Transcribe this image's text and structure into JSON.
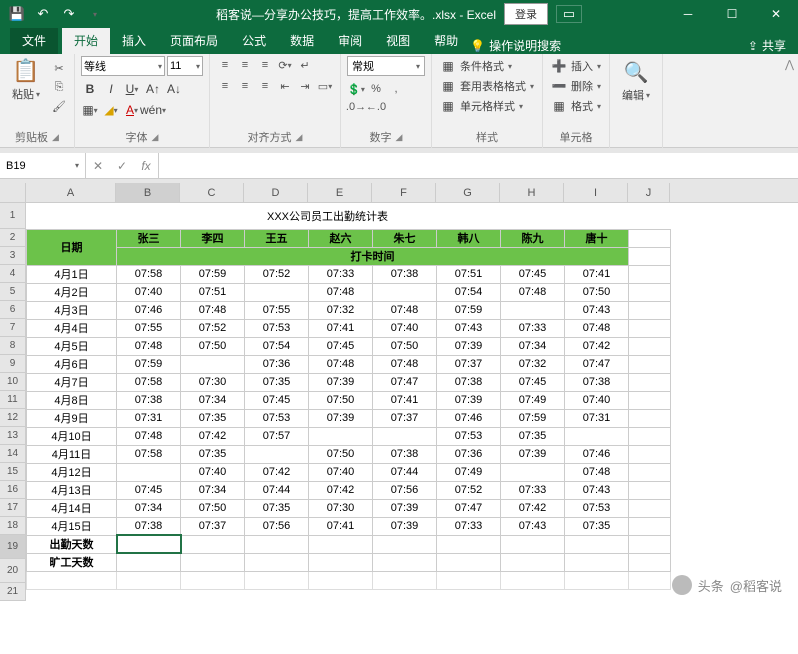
{
  "titlebar": {
    "title_text": "稻客说—分享办公技巧，提高工作效率。.xlsx - Excel",
    "login": "登录"
  },
  "tabs": {
    "file": "文件",
    "items": [
      "开始",
      "插入",
      "页面布局",
      "公式",
      "数据",
      "审阅",
      "视图",
      "帮助"
    ],
    "tellme": "操作说明搜索",
    "share": "共享"
  },
  "ribbon": {
    "paste": "粘贴",
    "clipboard": "剪贴板",
    "font_name": "等线",
    "font_size": "11",
    "font": "字体",
    "align": "对齐方式",
    "number_format": "常规",
    "number": "数字",
    "cond_format": "条件格式",
    "table_format": "套用表格格式",
    "cell_style": "单元格样式",
    "styles": "样式",
    "insert": "插入",
    "delete": "删除",
    "format": "格式",
    "cells": "单元格",
    "edit": "编辑"
  },
  "formula": {
    "name_box": "B19"
  },
  "columns": [
    "A",
    "B",
    "C",
    "D",
    "E",
    "F",
    "G",
    "H",
    "I",
    "J"
  ],
  "rows": [
    "1",
    "2",
    "3",
    "4",
    "5",
    "6",
    "7",
    "8",
    "9",
    "10",
    "11",
    "12",
    "13",
    "14",
    "15",
    "16",
    "17",
    "18",
    "19",
    "20",
    "21"
  ],
  "sheet": {
    "title": "XXX公司员工出勤统计表",
    "date_header": "日期",
    "sub_header": "打卡时间",
    "names": [
      "张三",
      "李四",
      "王五",
      "赵六",
      "朱七",
      "韩八",
      "陈九",
      "唐十"
    ],
    "data": [
      {
        "date": "4月1日",
        "v": [
          "07:58",
          "07:59",
          "07:52",
          "07:33",
          "07:38",
          "07:51",
          "07:45",
          "07:41"
        ]
      },
      {
        "date": "4月2日",
        "v": [
          "07:40",
          "07:51",
          "",
          "07:48",
          "",
          "07:54",
          "07:48",
          "07:50"
        ]
      },
      {
        "date": "4月3日",
        "v": [
          "07:46",
          "07:48",
          "07:55",
          "07:32",
          "07:48",
          "07:59",
          "",
          "07:43"
        ]
      },
      {
        "date": "4月4日",
        "v": [
          "07:55",
          "07:52",
          "07:53",
          "07:41",
          "07:40",
          "07:43",
          "07:33",
          "07:48"
        ]
      },
      {
        "date": "4月5日",
        "v": [
          "07:48",
          "07:50",
          "07:54",
          "07:45",
          "07:50",
          "07:39",
          "07:34",
          "07:42"
        ]
      },
      {
        "date": "4月6日",
        "v": [
          "07:59",
          "",
          "07:36",
          "07:48",
          "07:48",
          "07:37",
          "07:32",
          "07:47"
        ]
      },
      {
        "date": "4月7日",
        "v": [
          "07:58",
          "07:30",
          "07:35",
          "07:39",
          "07:47",
          "07:38",
          "07:45",
          "07:38"
        ]
      },
      {
        "date": "4月8日",
        "v": [
          "07:38",
          "07:34",
          "07:45",
          "07:50",
          "07:41",
          "07:39",
          "07:49",
          "07:40"
        ]
      },
      {
        "date": "4月9日",
        "v": [
          "07:31",
          "07:35",
          "07:53",
          "07:39",
          "07:37",
          "07:46",
          "07:59",
          "07:31"
        ]
      },
      {
        "date": "4月10日",
        "v": [
          "07:48",
          "07:42",
          "07:57",
          "",
          "",
          "07:53",
          "07:35",
          ""
        ]
      },
      {
        "date": "4月11日",
        "v": [
          "07:58",
          "07:35",
          "",
          "07:50",
          "07:38",
          "07:36",
          "07:39",
          "07:46"
        ]
      },
      {
        "date": "4月12日",
        "v": [
          "",
          "07:40",
          "07:42",
          "07:40",
          "07:44",
          "07:49",
          "",
          "07:48"
        ]
      },
      {
        "date": "4月13日",
        "v": [
          "07:45",
          "07:34",
          "07:44",
          "07:42",
          "07:56",
          "07:52",
          "07:33",
          "07:43"
        ]
      },
      {
        "date": "4月14日",
        "v": [
          "07:34",
          "07:50",
          "07:35",
          "07:30",
          "07:39",
          "07:47",
          "07:42",
          "07:53"
        ]
      },
      {
        "date": "4月15日",
        "v": [
          "07:38",
          "07:37",
          "07:56",
          "07:41",
          "07:39",
          "07:33",
          "07:43",
          "07:35"
        ]
      }
    ],
    "attendance": "出勤天数",
    "absence": "旷工天数"
  },
  "watermark": {
    "prefix": "头条",
    "name": "@稻客说"
  }
}
